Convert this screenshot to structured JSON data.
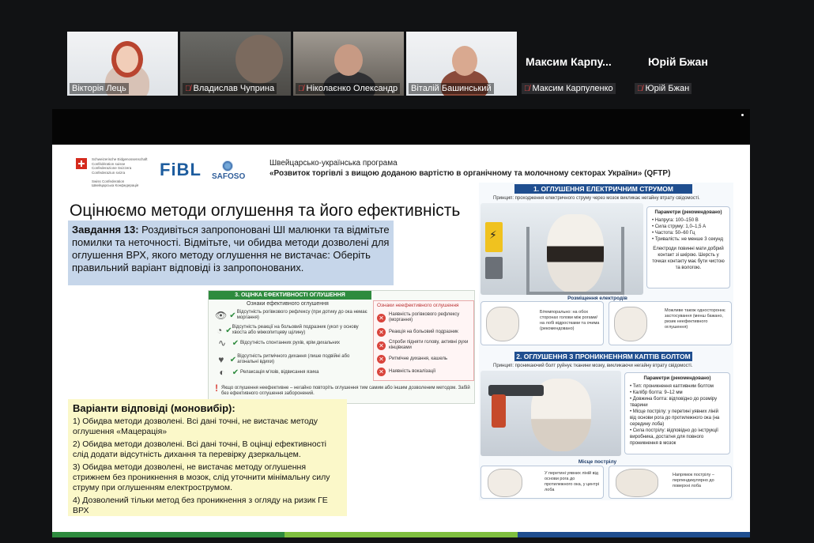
{
  "participants": [
    {
      "name": "Вікторія Лець",
      "muted": false,
      "type": "video-slide"
    },
    {
      "name": "Владислав Чуприна",
      "muted": true,
      "type": "video-room"
    },
    {
      "name": "Ніколаєнко Олександр",
      "muted": true,
      "type": "video-room"
    },
    {
      "name": "Віталій Башинський",
      "muted": false,
      "type": "video-slide",
      "active": true
    },
    {
      "name": "Максим Карпуленко",
      "big": "Максим  Карпу...",
      "muted": true,
      "type": "text"
    },
    {
      "name": "Юрій Бжан",
      "big": "Юрій Бжан",
      "muted": true,
      "type": "text"
    }
  ],
  "slide": {
    "swiss_lines": [
      "Schweizerische Eidgenossenschaft",
      "Confédération suisse",
      "Confederazione Svizzera",
      "Confederaziun svizra",
      "",
      "Swiss Confederation",
      "Швейцарська Конфедерація"
    ],
    "logo_fibl": "FiBL",
    "logo_safoso": "SAFOSO",
    "program_title": "Швейцарсько-українська програма",
    "program_subtitle": "«Розвиток торгівлі з вищою доданою вартістю в органічному та молочному секторах України» (QFTP)",
    "title": "Оцінюємо методи оглушення та його ефективність",
    "task_label": "Завдання 13:",
    "task_text": " Роздивіться запропоновані ШІ малюнки та відмітьте помилки та неточності. Відмітьте, чи обидва методи дозволені для оглушення ВРХ, якого методу оглушення не вистачає: Оберіть правильний варіант відповіді із запропонованих.",
    "efficiency": {
      "header": "3. ОЦІНКА ЕФЕКТИВНОСТІ ОГЛУШЕННЯ",
      "good_title": "Ознаки ефективного оглушення",
      "good": [
        {
          "icon": "👁",
          "text": "Відсутність рогівкового рефлексу (при дотику до ока немає моргання)"
        },
        {
          "icon": "◔",
          "text": "Відсутність реакції на больовий подразник (укол у основу хвоста або міжкопитцеву щілину)"
        },
        {
          "icon": "∿",
          "text": "Відсутність спонтанних рухів, крім дихальних"
        },
        {
          "icon": "♥",
          "text": "Відсутність ритмічного дихання (лише подвійні або агональні вдихи)"
        },
        {
          "icon": "◐",
          "text": "Релаксація м'язів, відвисання язика"
        }
      ],
      "bad_title": "Ознаки неефективного оглушення",
      "bad": [
        "Наявність рогівкового рефлексу (моргання)",
        "Реакція на больовий подразник",
        "Спроби підняти голову, активні рухи кінцівками",
        "Ритмічне дихання, кашель",
        "Наявність вокалізації"
      ],
      "warning": "Якщо оглушення неефективне – негайно повторіть оглушення тим самим або іншим дозволеним методом. Забій без ефективного оглушення заборонений."
    },
    "answers_title": "Варіанти відповіді (моновибір):",
    "answers": [
      "1) Обидва методи дозволені. Всі дані точні, не вистачає методу оглушення «Мацерація»",
      "2) Обидва методи дозволені. Всі дані точні, В оцінці ефективності слід додати відсутність дихання та перевірку дзеркальцем.",
      "3) Обидва методи дозволені, не вистачає методу оглушення стрижнем без проникнення в мозок, слід уточнити мінімальну силу струму при оглушенням електрострумом.",
      "4) Дозволений тільки метод без проникнення з огляду на ризик ГЕ ВРХ"
    ],
    "electric": {
      "band": "1. ОГЛУШЕННЯ ЕЛЕКТРИЧНИМ СТРУМОМ",
      "principle": "Принцип: проходження електричного струму через мозок викликає негайну втрату свідомості.",
      "params_title": "Параметри (рекомендовано)",
      "params": [
        "• Напруга: 100–150 В",
        "• Сила струму: 1,0–1,5 А",
        "• Частота: 50–60 Гц",
        "• Тривалість: не менше 3 секунд"
      ],
      "note": "Електроди повинні мати добрий контакт зі шкірою. Шерсть у точках контакту має бути чистою та вологою.",
      "placement_title": "Розміщення електродів",
      "placement_left": "Бітемпорально: на обох сторонах голови між рогами/на лобі відростками та очима (рекомендовано)",
      "placement_right": "Можливе також одностороннє застосування (менш бажано, ризик неефективного оглушення)"
    },
    "bolt": {
      "band": "2. ОГЛУШЕННЯ З ПРОНИКНЕННЯМ КАПТІВ БОЛТОМ",
      "principle": "Принцип: проникаючий болт руйнує тканини мозку, викликаючи негайну втрату свідомості.",
      "params_title": "Параметри (рекомендовано)",
      "params": [
        "• Тип: проникнення каптивним болтом",
        "• Калібр болта: 9–12 мм",
        "• Довжина болта: відповідно до розміру тварини",
        "• Місце пострілу: у перетині уявних ліній від основи рога до протилежного ока (на середину лоба)",
        "• Сила пострілу: відповідно до інструкції виробника, достатня для повного проникнення в мозок"
      ],
      "shot_title": "Місце пострілу",
      "shot_left": "У перетині уявних ліній від основи рога до протилежного ока, у центрі лоба",
      "shot_right": "Напрямок пострілу – перпендикулярно до поверхні лоба"
    }
  },
  "colors": {
    "active_speaker": "#2fbf71",
    "muted_icon": "#e04848",
    "task_bg": "#c6d6ea",
    "answers_bg": "#fbf8c9",
    "band_blue": "#1f4e8f",
    "eff_green": "#2e8b3e"
  }
}
